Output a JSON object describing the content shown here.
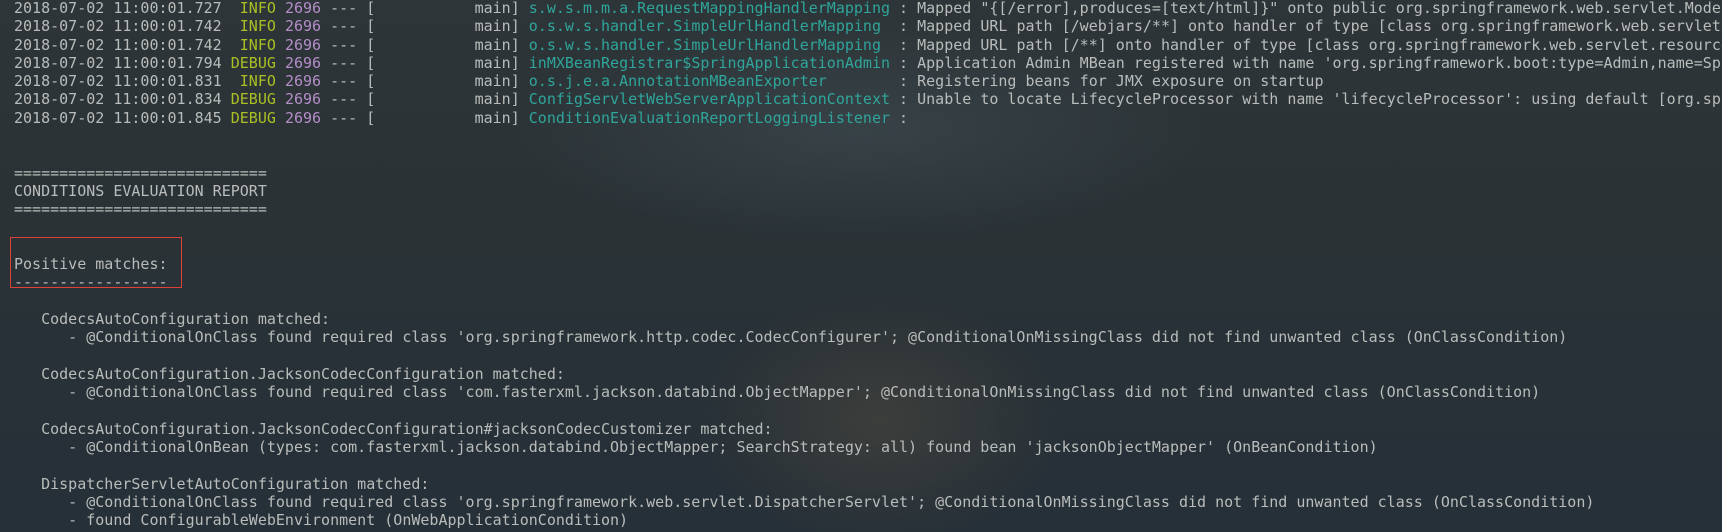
{
  "log_lines": [
    {
      "timestamp": "2018-07-02 11:00:01.727",
      "level": " INFO",
      "pid": "2696",
      "thread": "main",
      "logger": "s.w.s.m.m.a.RequestMappingHandlerMapping",
      "message": "Mapped \"{[/error],produces=[text/html]}\" onto public org.springframework.web.servlet.ModelAndView"
    },
    {
      "timestamp": "2018-07-02 11:00:01.742",
      "level": " INFO",
      "pid": "2696",
      "thread": "main",
      "logger": "o.s.w.s.handler.SimpleUrlHandlerMapping ",
      "message": "Mapped URL path [/webjars/**] onto handler of type [class org.springframework.web.servlet.resource"
    },
    {
      "timestamp": "2018-07-02 11:00:01.742",
      "level": " INFO",
      "pid": "2696",
      "thread": "main",
      "logger": "o.s.w.s.handler.SimpleUrlHandlerMapping ",
      "message": "Mapped URL path [/**] onto handler of type [class org.springframework.web.servlet.resource"
    },
    {
      "timestamp": "2018-07-02 11:00:01.794",
      "level": "DEBUG",
      "pid": "2696",
      "thread": "main",
      "logger": "inMXBeanRegistrar$SpringApplicationAdmin",
      "message": "Application Admin MBean registered with name 'org.springframework.boot:type=Admin,name=Spr"
    },
    {
      "timestamp": "2018-07-02 11:00:01.831",
      "level": " INFO",
      "pid": "2696",
      "thread": "main",
      "logger": "o.s.j.e.a.AnnotationMBeanExporter       ",
      "message": "Registering beans for JMX exposure on startup"
    },
    {
      "timestamp": "2018-07-02 11:00:01.834",
      "level": "DEBUG",
      "pid": "2696",
      "thread": "main",
      "logger": "ConfigServletWebServerApplicationContext",
      "message": "Unable to locate LifecycleProcessor with name 'lifecycleProcessor': using default [org.spr"
    },
    {
      "timestamp": "2018-07-02 11:00:01.845",
      "level": "DEBUG",
      "pid": "2696",
      "thread": "main",
      "logger": "ConditionEvaluationReportLoggingListener",
      "message": ""
    }
  ],
  "colors": {
    "level": "#a9bf24",
    "pid": "#b48ec9",
    "logger": "#2fa59b",
    "text": "#b9bcba",
    "highlight_box": "#e0403a"
  },
  "report": {
    "rule": "============================",
    "title": "CONDITIONS EVALUATION REPORT",
    "section_title": "Positive matches:",
    "section_rule": "-----------------",
    "entries": [
      {
        "name": "   CodecsAutoConfiguration matched:",
        "details": [
          "      - @ConditionalOnClass found required class 'org.springframework.http.codec.CodecConfigurer'; @ConditionalOnMissingClass did not find unwanted class (OnClassCondition)"
        ]
      },
      {
        "name": "   CodecsAutoConfiguration.JacksonCodecConfiguration matched:",
        "details": [
          "      - @ConditionalOnClass found required class 'com.fasterxml.jackson.databind.ObjectMapper'; @ConditionalOnMissingClass did not find unwanted class (OnClassCondition)"
        ]
      },
      {
        "name": "   CodecsAutoConfiguration.JacksonCodecConfiguration#jacksonCodecCustomizer matched:",
        "details": [
          "      - @ConditionalOnBean (types: com.fasterxml.jackson.databind.ObjectMapper; SearchStrategy: all) found bean 'jacksonObjectMapper' (OnBeanCondition)"
        ]
      },
      {
        "name": "   DispatcherServletAutoConfiguration matched:",
        "details": [
          "      - @ConditionalOnClass found required class 'org.springframework.web.servlet.DispatcherServlet'; @ConditionalOnMissingClass did not find unwanted class (OnClassCondition)",
          "      - found ConfigurableWebEnvironment (OnWebApplicationCondition)"
        ]
      }
    ]
  }
}
